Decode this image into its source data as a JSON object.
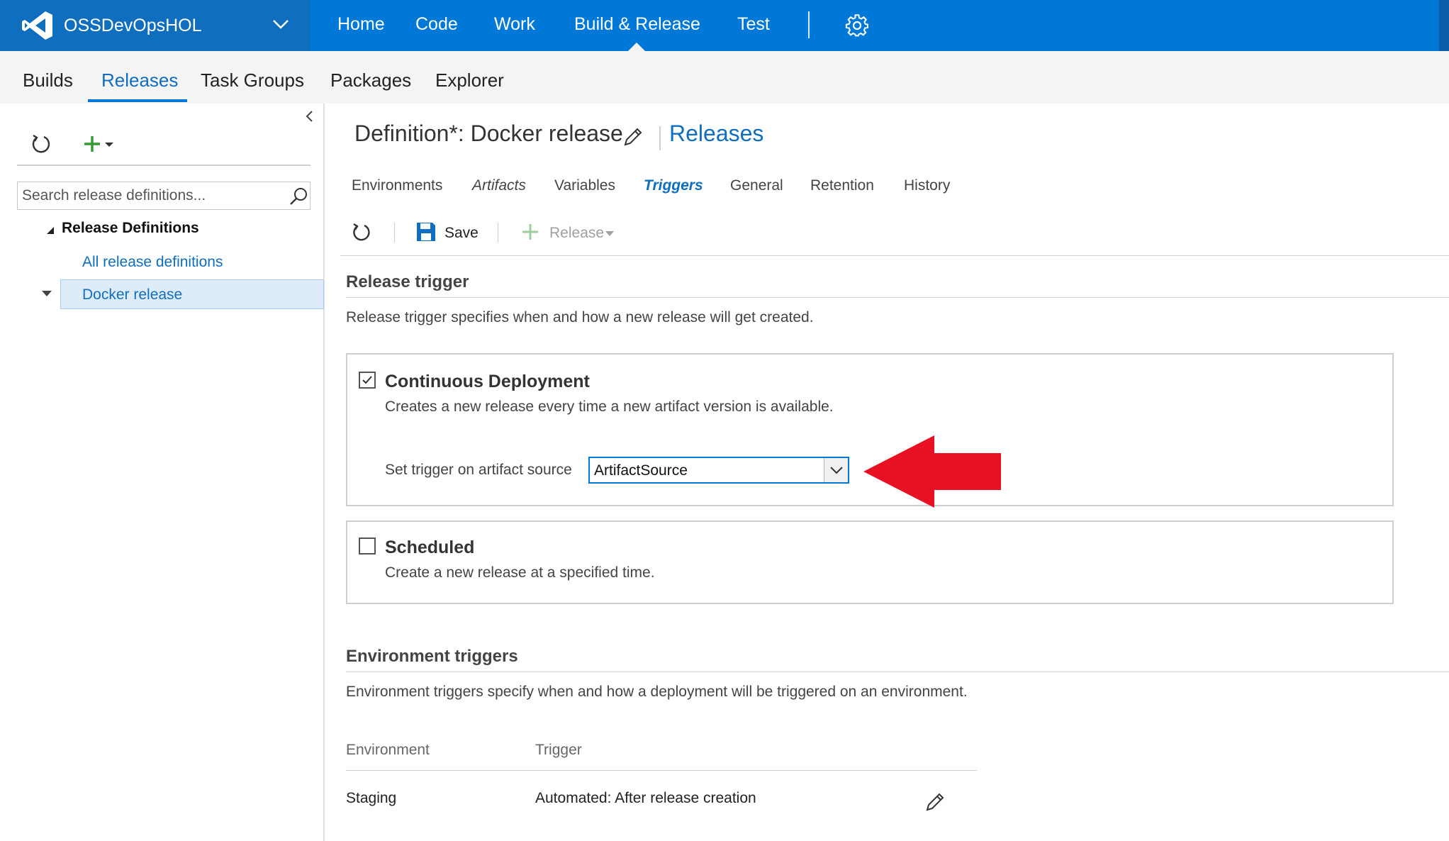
{
  "account": {
    "name": "OSSDevOpsHOL"
  },
  "top_nav": {
    "home": "Home",
    "code": "Code",
    "work": "Work",
    "build_release": "Build & Release",
    "test": "Test"
  },
  "sub_nav": {
    "builds": "Builds",
    "releases": "Releases",
    "task_groups": "Task Groups",
    "packages": "Packages",
    "explorer": "Explorer"
  },
  "left_panel": {
    "search_placeholder": "Search release definitions...",
    "tree_root": "Release Definitions",
    "all_definitions": "All release definitions",
    "selected_definition": "Docker release"
  },
  "header": {
    "title": "Definition*: Docker release",
    "releases_link": "Releases"
  },
  "tabs": {
    "environments": "Environments",
    "artifacts": "Artifacts",
    "variables": "Variables",
    "triggers": "Triggers",
    "general": "General",
    "retention": "Retention",
    "history": "History"
  },
  "toolbar": {
    "save": "Save",
    "release": "Release"
  },
  "release_trigger": {
    "heading": "Release trigger",
    "description": "Release trigger specifies when and how a new release will get created.",
    "continuous": {
      "checked": true,
      "title": "Continuous Deployment",
      "description": "Creates a new release every time a new artifact version is available.",
      "source_label": "Set trigger on artifact source",
      "source_value": "ArtifactSource"
    },
    "scheduled": {
      "checked": false,
      "title": "Scheduled",
      "description": "Create a new release at a specified time."
    }
  },
  "environment_triggers": {
    "heading": "Environment triggers",
    "description": "Environment triggers specify when and how a deployment will be triggered on an environment.",
    "columns": {
      "environment": "Environment",
      "trigger": "Trigger"
    },
    "rows": [
      {
        "environment": "Staging",
        "trigger": "Automated: After release creation"
      }
    ]
  },
  "colors": {
    "brand_blue": "#0078d7",
    "account_blue": "#106ebe",
    "add_green": "#339933",
    "annotation_red": "#e81123"
  }
}
